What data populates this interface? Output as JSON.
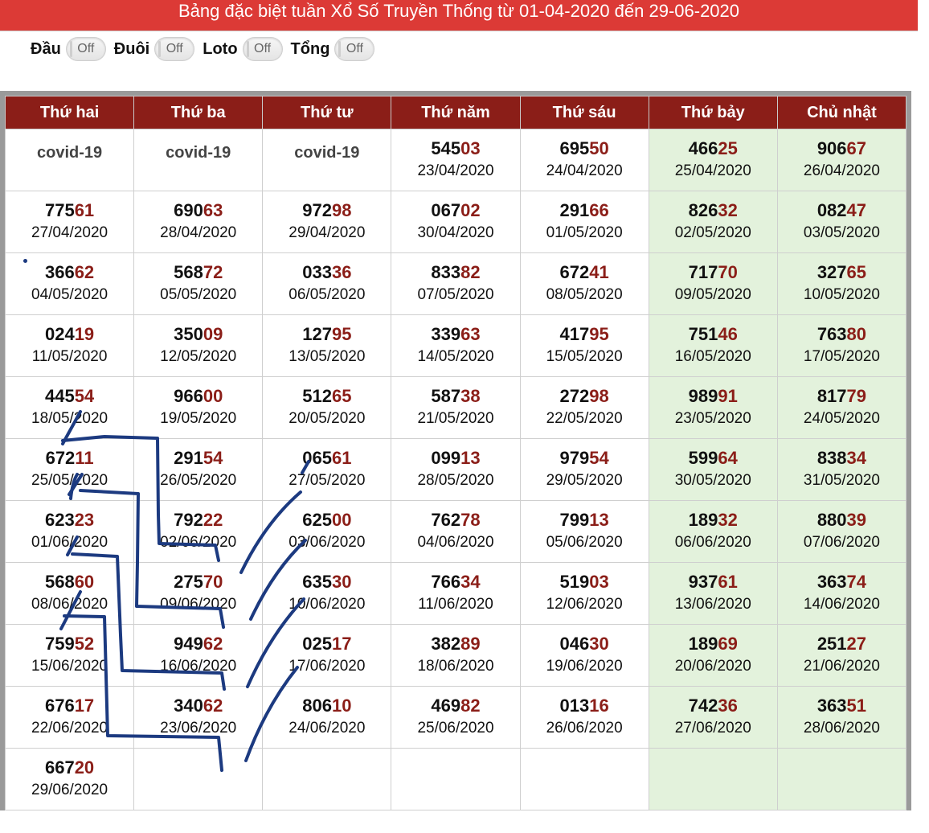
{
  "header": {
    "title": "Bảng đặc biệt tuần Xổ Số Truyền Thống từ 01-04-2020 đến 29-06-2020"
  },
  "filters": [
    {
      "label": "Đầu",
      "state": "Off"
    },
    {
      "label": "Đuôi",
      "state": "Off"
    },
    {
      "label": "Loto",
      "state": "Off"
    },
    {
      "label": "Tổng",
      "state": "Off"
    }
  ],
  "table": {
    "columns": [
      "Thứ hai",
      "Thứ ba",
      "Thứ tư",
      "Thứ năm",
      "Thứ sáu",
      "Thứ bảy",
      "Chủ nhật"
    ],
    "weekend_columns": [
      5,
      6
    ],
    "rows": [
      [
        {
          "text": "covid-19"
        },
        {
          "text": "covid-19"
        },
        {
          "text": "covid-19"
        },
        {
          "prefix": "545",
          "tail": "03",
          "date": "23/04/2020"
        },
        {
          "prefix": "695",
          "tail": "50",
          "date": "24/04/2020"
        },
        {
          "prefix": "466",
          "tail": "25",
          "date": "25/04/2020"
        },
        {
          "prefix": "906",
          "tail": "67",
          "date": "26/04/2020"
        }
      ],
      [
        {
          "prefix": "775",
          "tail": "61",
          "date": "27/04/2020"
        },
        {
          "prefix": "690",
          "tail": "63",
          "date": "28/04/2020"
        },
        {
          "prefix": "972",
          "tail": "98",
          "date": "29/04/2020"
        },
        {
          "prefix": "067",
          "tail": "02",
          "date": "30/04/2020"
        },
        {
          "prefix": "291",
          "tail": "66",
          "date": "01/05/2020"
        },
        {
          "prefix": "826",
          "tail": "32",
          "date": "02/05/2020"
        },
        {
          "prefix": "082",
          "tail": "47",
          "date": "03/05/2020"
        }
      ],
      [
        {
          "prefix": "366",
          "tail": "62",
          "date": "04/05/2020"
        },
        {
          "prefix": "568",
          "tail": "72",
          "date": "05/05/2020"
        },
        {
          "prefix": "033",
          "tail": "36",
          "date": "06/05/2020"
        },
        {
          "prefix": "833",
          "tail": "82",
          "date": "07/05/2020"
        },
        {
          "prefix": "672",
          "tail": "41",
          "date": "08/05/2020"
        },
        {
          "prefix": "717",
          "tail": "70",
          "date": "09/05/2020"
        },
        {
          "prefix": "327",
          "tail": "65",
          "date": "10/05/2020"
        }
      ],
      [
        {
          "prefix": "024",
          "tail": "19",
          "date": "11/05/2020"
        },
        {
          "prefix": "350",
          "tail": "09",
          "date": "12/05/2020"
        },
        {
          "prefix": "127",
          "tail": "95",
          "date": "13/05/2020"
        },
        {
          "prefix": "339",
          "tail": "63",
          "date": "14/05/2020"
        },
        {
          "prefix": "417",
          "tail": "95",
          "date": "15/05/2020"
        },
        {
          "prefix": "751",
          "tail": "46",
          "date": "16/05/2020"
        },
        {
          "prefix": "763",
          "tail": "80",
          "date": "17/05/2020"
        }
      ],
      [
        {
          "prefix": "445",
          "tail": "54",
          "date": "18/05/2020"
        },
        {
          "prefix": "966",
          "tail": "00",
          "date": "19/05/2020"
        },
        {
          "prefix": "512",
          "tail": "65",
          "date": "20/05/2020"
        },
        {
          "prefix": "587",
          "tail": "38",
          "date": "21/05/2020"
        },
        {
          "prefix": "272",
          "tail": "98",
          "date": "22/05/2020"
        },
        {
          "prefix": "989",
          "tail": "91",
          "date": "23/05/2020"
        },
        {
          "prefix": "817",
          "tail": "79",
          "date": "24/05/2020"
        }
      ],
      [
        {
          "prefix": "672",
          "tail": "11",
          "date": "25/05/2020"
        },
        {
          "prefix": "291",
          "tail": "54",
          "date": "26/05/2020"
        },
        {
          "prefix": "065",
          "tail": "61",
          "date": "27/05/2020"
        },
        {
          "prefix": "099",
          "tail": "13",
          "date": "28/05/2020"
        },
        {
          "prefix": "979",
          "tail": "54",
          "date": "29/05/2020"
        },
        {
          "prefix": "599",
          "tail": "64",
          "date": "30/05/2020"
        },
        {
          "prefix": "838",
          "tail": "34",
          "date": "31/05/2020"
        }
      ],
      [
        {
          "prefix": "623",
          "tail": "23",
          "date": "01/06/2020"
        },
        {
          "prefix": "792",
          "tail": "22",
          "date": "02/06/2020"
        },
        {
          "prefix": "625",
          "tail": "00",
          "date": "03/06/2020"
        },
        {
          "prefix": "762",
          "tail": "78",
          "date": "04/06/2020"
        },
        {
          "prefix": "799",
          "tail": "13",
          "date": "05/06/2020"
        },
        {
          "prefix": "189",
          "tail": "32",
          "date": "06/06/2020"
        },
        {
          "prefix": "880",
          "tail": "39",
          "date": "07/06/2020"
        }
      ],
      [
        {
          "prefix": "568",
          "tail": "60",
          "date": "08/06/2020"
        },
        {
          "prefix": "275",
          "tail": "70",
          "date": "09/06/2020"
        },
        {
          "prefix": "635",
          "tail": "30",
          "date": "10/06/2020"
        },
        {
          "prefix": "766",
          "tail": "34",
          "date": "11/06/2020"
        },
        {
          "prefix": "519",
          "tail": "03",
          "date": "12/06/2020"
        },
        {
          "prefix": "937",
          "tail": "61",
          "date": "13/06/2020"
        },
        {
          "prefix": "363",
          "tail": "74",
          "date": "14/06/2020"
        }
      ],
      [
        {
          "prefix": "759",
          "tail": "52",
          "date": "15/06/2020"
        },
        {
          "prefix": "949",
          "tail": "62",
          "date": "16/06/2020"
        },
        {
          "prefix": "025",
          "tail": "17",
          "date": "17/06/2020"
        },
        {
          "prefix": "382",
          "tail": "89",
          "date": "18/06/2020"
        },
        {
          "prefix": "046",
          "tail": "30",
          "date": "19/06/2020"
        },
        {
          "prefix": "189",
          "tail": "69",
          "date": "20/06/2020"
        },
        {
          "prefix": "251",
          "tail": "27",
          "date": "21/06/2020"
        }
      ],
      [
        {
          "prefix": "676",
          "tail": "17",
          "date": "22/06/2020"
        },
        {
          "prefix": "340",
          "tail": "62",
          "date": "23/06/2020"
        },
        {
          "prefix": "806",
          "tail": "10",
          "date": "24/06/2020"
        },
        {
          "prefix": "469",
          "tail": "82",
          "date": "25/06/2020"
        },
        {
          "prefix": "013",
          "tail": "16",
          "date": "26/06/2020"
        },
        {
          "prefix": "742",
          "tail": "36",
          "date": "27/06/2020"
        },
        {
          "prefix": "363",
          "tail": "51",
          "date": "28/06/2020"
        }
      ],
      [
        {
          "prefix": "667",
          "tail": "20",
          "date": "29/06/2020"
        },
        {},
        {},
        {},
        {},
        {},
        {}
      ]
    ]
  },
  "colors": {
    "header_bar": "#dc3a36",
    "column_header": "#8b1e18",
    "tail_digits": "#8b1e18",
    "weekend_bg": "#e3f2dc",
    "handwriting_ink": "#1c3a80"
  }
}
